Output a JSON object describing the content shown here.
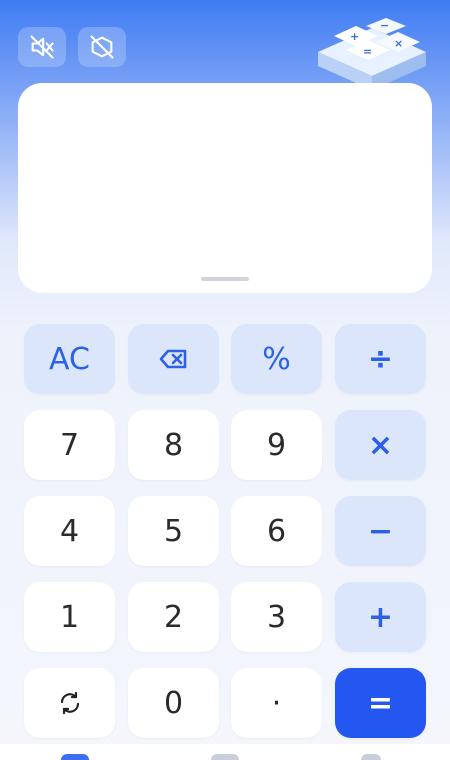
{
  "colors": {
    "accent": "#2457f0",
    "operator_text": "#2c60e6",
    "operator_bg": "#dbe6fa",
    "digit_bg": "#ffffff",
    "digit_text": "#2b2b2b"
  },
  "top_bar": {
    "mute_icon": "speaker-muted-icon",
    "rotate_lock_icon": "rotation-lock-icon",
    "logo_icon": "calculator-blocks-logo"
  },
  "display": {
    "expression": "",
    "result": ""
  },
  "keys": {
    "row1": [
      "AC",
      "⌫",
      "%",
      "÷"
    ],
    "row2": [
      "7",
      "8",
      "9",
      "×"
    ],
    "row3": [
      "4",
      "5",
      "6",
      "−"
    ],
    "row4": [
      "1",
      "2",
      "3",
      "+"
    ],
    "row5": [
      "⟳",
      "0",
      "·",
      "="
    ]
  },
  "bottom_nav": {
    "icons": [
      "calculator-tab-icon",
      "converter-tab-icon",
      "profile-tab-icon"
    ]
  }
}
